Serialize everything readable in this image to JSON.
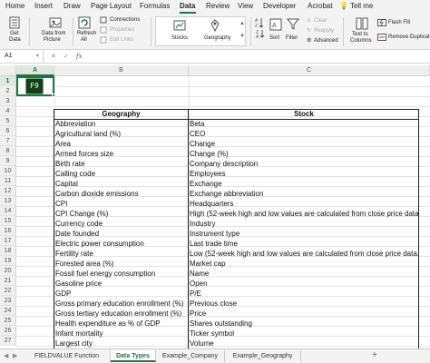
{
  "ribbon_tabs": [
    "Home",
    "Insert",
    "Draw",
    "Page Layout",
    "Formulas",
    "Data",
    "Review",
    "View",
    "Developer",
    "Acrobat"
  ],
  "active_tab": "Data",
  "tell_me": "Tell me",
  "ribbon": {
    "get_data": [
      "Get",
      "Data"
    ],
    "data_from_picture": [
      "Data from",
      "Picture"
    ],
    "refresh_all": [
      "Refresh",
      "All"
    ],
    "connections": "Connections",
    "properties": "Properties",
    "edit_links": "Edit Links",
    "stocks": "Stocks",
    "geography": "Geography",
    "sort": "Sort",
    "filter": "Filter",
    "clear": "Clear",
    "reapply": "Reapply",
    "advanced": "Advanced",
    "text_to_columns": [
      "Text to",
      "Columns"
    ],
    "flash_fill": "Flash Fill",
    "remove_duplicates": "Remove Duplicat"
  },
  "formula_bar": {
    "name_box": "A1",
    "cancel": "✕",
    "enter": "✓",
    "fx": "fx",
    "formula": ""
  },
  "columns": [
    "A",
    "B",
    "C"
  ],
  "rows": [
    "1",
    "2",
    "3",
    "4",
    "5",
    "6",
    "7",
    "8",
    "9",
    "10",
    "11",
    "12",
    "13",
    "14",
    "15",
    "16",
    "17",
    "18",
    "19",
    "20",
    "21",
    "22",
    "23",
    "24",
    "25",
    "26",
    "27"
  ],
  "f9_key": "F9",
  "table": {
    "geography_header": "Geography",
    "stock_header": "Stock",
    "geography": [
      "Abbreviation",
      "Agricultural land (%)",
      "Area",
      "Armed forces size",
      "Birth rate",
      "Calling code",
      "Capital",
      "Carbon dioxide emissions",
      "CPI",
      "CPI Change (%)",
      "Currency code",
      "Date founded",
      "Electric power consumption",
      "Fertility rate",
      "Forested area (%)",
      "Fossil fuel energy consumption",
      "Gasoline price",
      "GDP",
      "Gross primary education enrollment (%)",
      "Gross tertiary education enrollment (%)",
      "Health expenditure as % of GDP",
      "Infant mortality",
      "Largest city"
    ],
    "stock": [
      "Beta",
      "CEO",
      "Change",
      "Change (%)",
      "Company description",
      "Employees",
      "Exchange",
      "Exchange abbreviation",
      "Headquarters",
      "High (52-week high and low values are calculated from close price data.)",
      "Industry",
      "Instrument type",
      "Last trade time",
      "Low (52-week high and low values are calculated from close price data.)",
      "Market cap",
      "Name",
      "Open",
      "P/E",
      "Previous close",
      "Price",
      "Shares outstanding",
      "Ticker symbol",
      "Volume"
    ]
  },
  "sheet_tabs": [
    "FIELDVALUE Function",
    "Data Types",
    "Example_Company",
    "Example_Geography"
  ],
  "active_sheet": "Data Types",
  "colors": {
    "accent": "#217346",
    "ribbon_bg": "#f3f3f3"
  }
}
